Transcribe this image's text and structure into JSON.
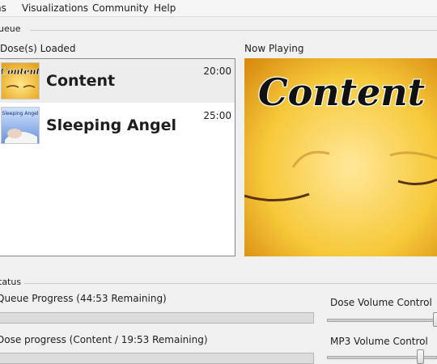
{
  "menu": [
    "ns",
    "Visualizations",
    "Community",
    "Help"
  ],
  "queue": {
    "legend": "ueue"
  },
  "doses": {
    "label": "Dose(s) Loaded",
    "items": [
      {
        "title": "Content",
        "duration": "20:00",
        "thumb_text": "Content",
        "selected": true
      },
      {
        "title": "Sleeping Angel",
        "duration": "25:00",
        "thumb_text": "Sleeping Angel",
        "selected": false
      }
    ]
  },
  "now_playing": {
    "label": "Now Playing",
    "image_text": "Content"
  },
  "status": {
    "legend": "tatus",
    "queue_progress": {
      "label": "Queue Progress (44:53 Remaining)",
      "fraction": 0.0
    },
    "dose_progress": {
      "label": "Dose progress (Content / 19:53 Remaining)",
      "fraction": 0.0
    }
  },
  "volume": {
    "dose_label": "Dose Volume Control",
    "mp3_label": "MP3 Volume Control"
  },
  "colors": {
    "selected_row": "#ededed",
    "progress_fill": "#3fa93f",
    "face_yellow": "#f5d020"
  }
}
